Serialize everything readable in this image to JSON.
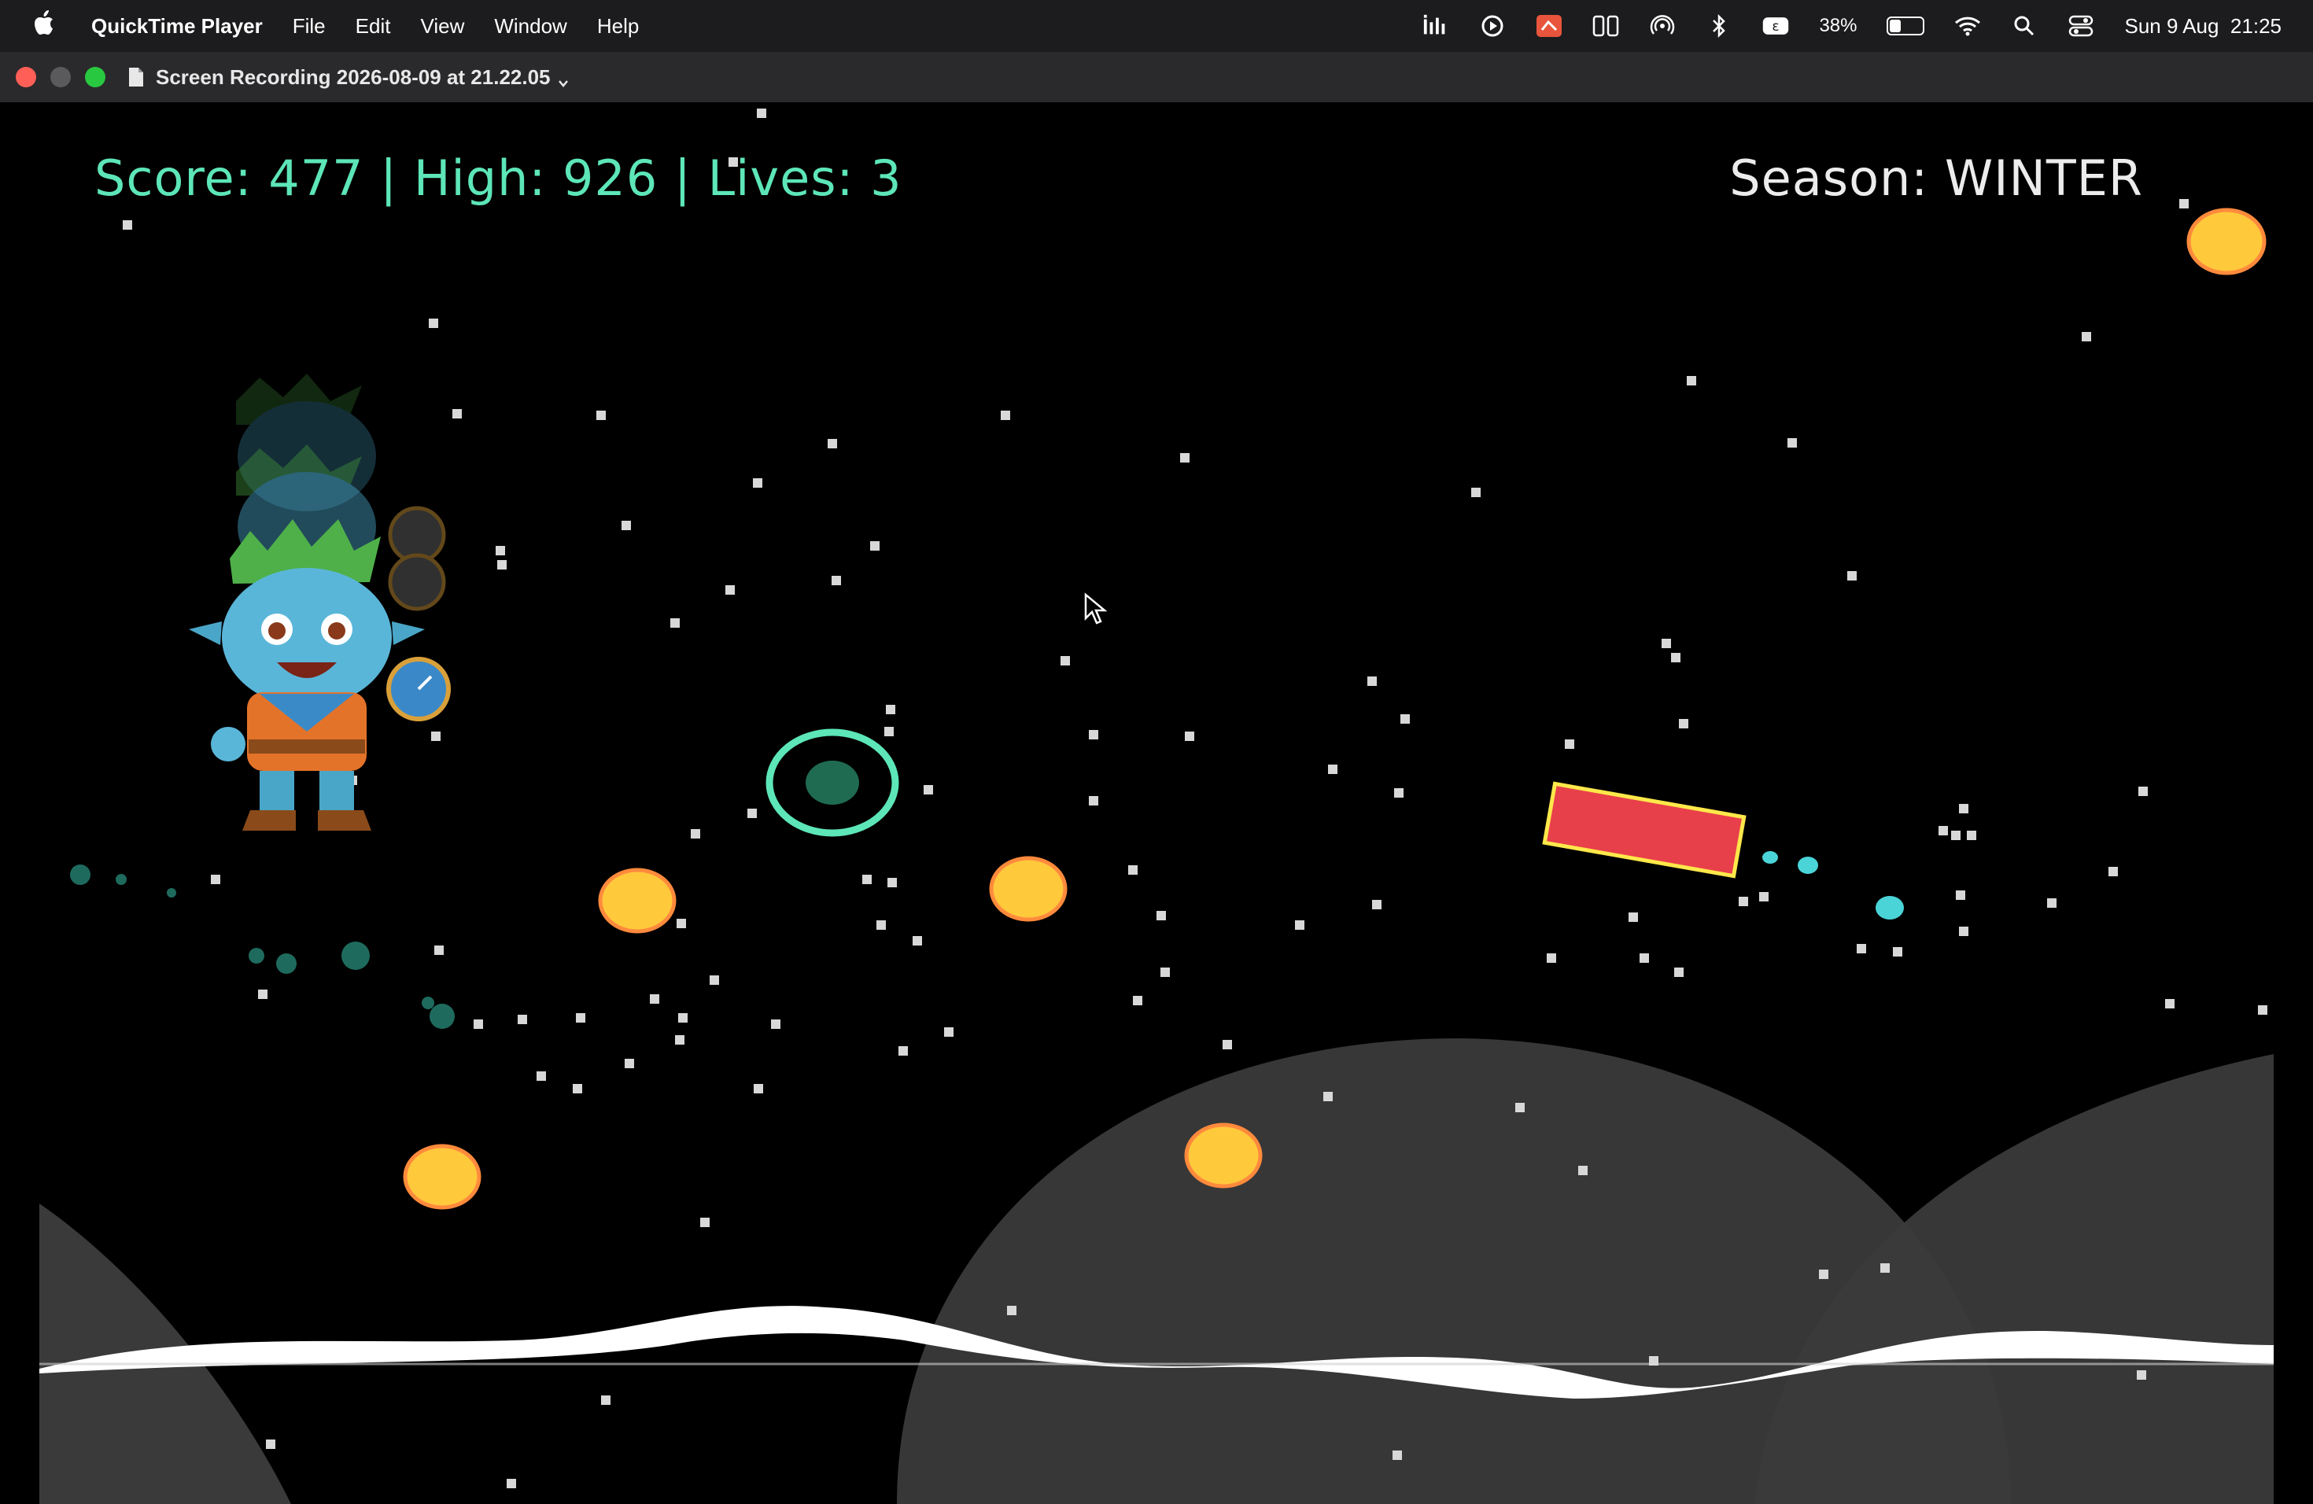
{
  "menubar": {
    "app_name": "QuickTime Player",
    "menus": [
      "File",
      "Edit",
      "View",
      "Window",
      "Help"
    ],
    "battery_percent": "38%",
    "battery_level": 0.38,
    "datetime": "Sun 9 Aug  21:25",
    "status_icons": [
      "stats-icon",
      "play-circle-icon",
      "app-badge-icon",
      "screen-mirror-icon",
      "airdrop-icon",
      "bluetooth-icon",
      "keyboard-input-icon",
      "battery-icon",
      "wifi-icon",
      "search-icon",
      "control-center-icon"
    ]
  },
  "window": {
    "title": "Screen Recording 2026-08-09 at 21.22.05",
    "buttons": [
      "close",
      "minimize",
      "zoom"
    ]
  },
  "game": {
    "score_label": "Score",
    "score": 477,
    "high_label": "High",
    "high": 926,
    "lives_label": "Lives",
    "lives": 3,
    "hud_text": "Score: 477 | High: 926 | Lives: 3",
    "season_text": "Season: WINTER",
    "season": "WINTER",
    "colors": {
      "hud": "#5de6b8",
      "coin": "#ffc93c",
      "coin_border": "#ff8a3c",
      "obstacle": "#e8404a",
      "obstacle_border": "#ffe84a",
      "portal": "#5de6b8",
      "hills": "#3a3a3a",
      "snow": "#ffffff"
    }
  }
}
